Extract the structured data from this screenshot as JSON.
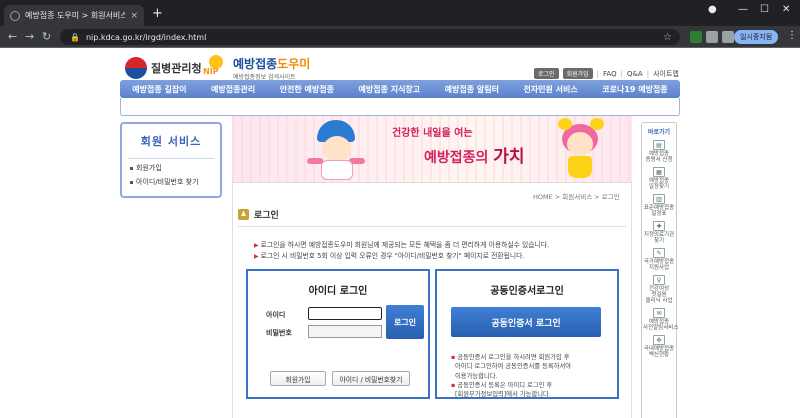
{
  "browser": {
    "tab_title": "예방접종 도우미 > 회원서비스 > ...",
    "tab_close": "×",
    "new_tab": "+",
    "url": "nip.kdca.go.kr/irgd/index.html",
    "profile_label": "일시중지됨",
    "win_min": "—",
    "win_max": "☐",
    "win_close": "✕",
    "nav_back": "←",
    "nav_forward": "→",
    "nav_reload": "↻",
    "menu": "⋮"
  },
  "header": {
    "agency": "질병관리청",
    "site_title_a": "예방접종",
    "site_title_b": "도우미",
    "site_sub": "예방접종정보 검색사이트",
    "nip": "NIP",
    "login_btn": "로그인",
    "join_btn": "회원가입",
    "faq": "FAQ",
    "qna": "Q&A",
    "sitemap": "사이트맵",
    "sep": "|"
  },
  "gnb": [
    "예방접종 길잡이",
    "예방접종관리",
    "안전한 예방접종",
    "예방접종 지식창고",
    "예방접종 알림터",
    "전자민원 서비스",
    "코로나19 예방접종"
  ],
  "lnb": {
    "title": "회원 서비스",
    "items": [
      "회원가입",
      "아이디/비밀번호 찾기"
    ]
  },
  "banner": {
    "slogan1": "건강한 내일을 여는",
    "slogan2a": "예방접종의",
    "slogan2b": "가치"
  },
  "quick": {
    "title": "바로가기",
    "items": [
      "예방접종 증명서 신청",
      "예방접종 일정찾기",
      "표준예방접종 일정표",
      "지정의료기관 찾기",
      "국가예방접종 지원사업",
      "건강여성 첫걸음 클리닉 사업",
      "예방접종 사전알림서비스",
      "국내예방접종 백신현황"
    ]
  },
  "content": {
    "breadcrumb": "HOME > 회원서비스 > 로그인",
    "title": "로그인",
    "notices": [
      "로그인을 하시면 예방접종도우미 회원님께 제공되는 모든 혜택을 좀 더 편리하게 이용하실수 있습니다.",
      "로그인 시 비밀번호 5회 이상 입력 오류인 경우 \"아이디/비밀번호 찾기\" 페이지로 전환됩니다."
    ],
    "id_login": {
      "title": "아이디 로그인",
      "id_label": "아이디",
      "pw_label": "비밀번호",
      "id_value": "",
      "pw_value": "",
      "login_button": "로그인",
      "join_button": "회원가입",
      "find_button": "아이디 / 비밀번호찾기"
    },
    "cert_login": {
      "title": "공동인증서로그인",
      "button": "공동인증서 로그인",
      "notes": [
        "공동인증서 로그인을 하시려면 회원가입 후",
        "아이디 로그인하여 공동인증서를 등록하셔야",
        "이용가능합니다.",
        "공동인증서 등록은 아이디 로그인 후",
        "[회원부가정보입력]에서 가능합니다."
      ]
    }
  },
  "colors": {
    "gnb": "#5b82cf",
    "accent": "#2a5fb0",
    "banner_text": "#d42060"
  }
}
